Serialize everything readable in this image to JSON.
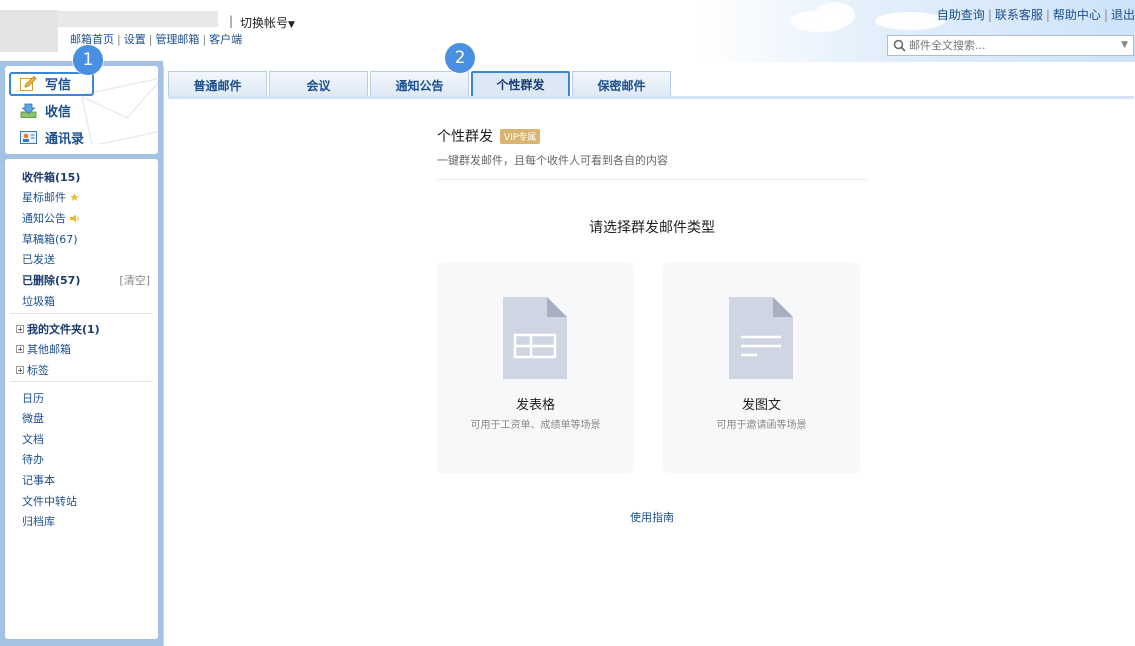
{
  "header": {
    "switch_sep": "|",
    "switch_account": "切换帐号",
    "top_links": [
      "邮箱首页",
      "设置",
      "管理邮箱",
      "客户端"
    ],
    "right_links": [
      "自助查询",
      "联系客服",
      "帮助中心",
      "退出"
    ],
    "search_placeholder": "邮件全文搜索..."
  },
  "sidebar": {
    "actions": [
      {
        "label": "写信",
        "icon": "compose-icon"
      },
      {
        "label": "收信",
        "icon": "inbox-download-icon"
      },
      {
        "label": "通讯录",
        "icon": "contacts-icon"
      }
    ],
    "folders": [
      {
        "label": "收件箱(15)",
        "bold": true
      },
      {
        "label": "星标邮件",
        "icon": "star-icon"
      },
      {
        "label": "通知公告",
        "icon": "speaker-icon"
      },
      {
        "label": "草稿箱(67)"
      },
      {
        "label": "已发送"
      },
      {
        "label": "已删除(57)",
        "bold": true,
        "action": "[清空]"
      },
      {
        "label": "垃圾箱"
      }
    ],
    "trees": [
      {
        "label": "我的文件夹(1)",
        "bold": true
      },
      {
        "label": "其他邮箱"
      },
      {
        "label": "标签"
      }
    ],
    "apps": [
      "日历",
      "微盘",
      "文档",
      "待办",
      "记事本",
      "文件中转站",
      "归档库"
    ]
  },
  "tabs": [
    {
      "label": "普通邮件",
      "active": false
    },
    {
      "label": "会议",
      "active": false
    },
    {
      "label": "通知公告",
      "active": false
    },
    {
      "label": "个性群发",
      "active": true
    },
    {
      "label": "保密邮件",
      "active": false
    }
  ],
  "main": {
    "title": "个性群发",
    "badge": "VIP专属",
    "subtitle": "一键群发邮件，且每个收件人可看到各自的内容",
    "choose_title": "请选择群发邮件类型",
    "cards": [
      {
        "title": "发表格",
        "desc": "可用于工资单、成绩单等场景",
        "icon": "spreadsheet-doc-icon"
      },
      {
        "title": "发图文",
        "desc": "可用于邀请函等场景",
        "icon": "text-doc-icon"
      }
    ],
    "guide": "使用指南"
  },
  "markers": [
    "1",
    "2"
  ],
  "colors": {
    "accent": "#3b86d6",
    "marker": "#4a90e2",
    "frame": "#a4c2e4",
    "link": "#1d4f8c",
    "vip": "#d9b56f"
  }
}
